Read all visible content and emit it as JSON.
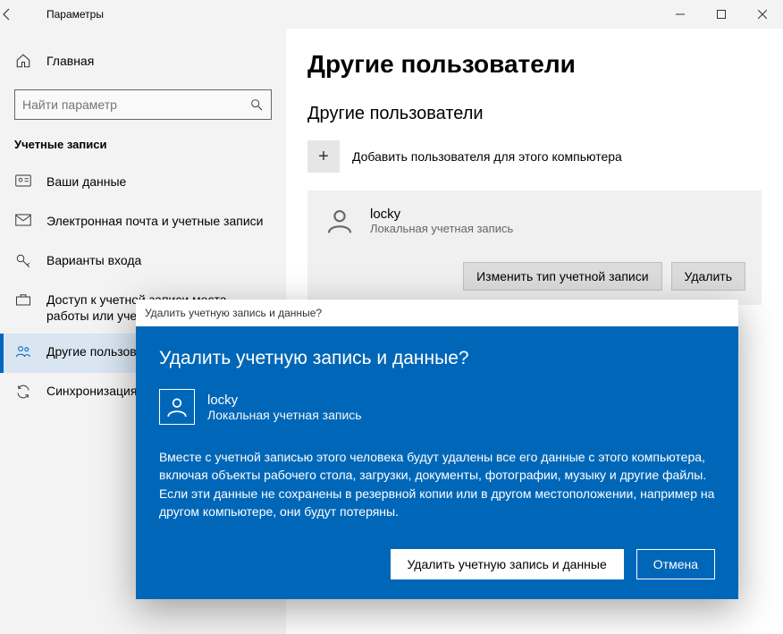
{
  "window": {
    "title": "Параметры"
  },
  "sidebar": {
    "home_label": "Главная",
    "search_placeholder": "Найти параметр",
    "section_title": "Учетные записи",
    "items": [
      {
        "label": "Ваши данные"
      },
      {
        "label": "Электронная почта и учетные записи"
      },
      {
        "label": "Варианты входа"
      },
      {
        "label": "Доступ к учетной записи места работы или учебного заведения"
      },
      {
        "label": "Другие пользователи"
      },
      {
        "label": "Синхронизация ваших параметров"
      }
    ]
  },
  "main": {
    "heading": "Другие пользователи",
    "sub_heading": "Другие пользователи",
    "add_user_label": "Добавить пользователя для этого компьютера",
    "user": {
      "name": "locky",
      "type": "Локальная учетная запись"
    },
    "change_type_label": "Изменить тип учетной записи",
    "delete_label": "Удалить"
  },
  "dialog": {
    "titlebar": "Удалить учетную запись и данные?",
    "heading": "Удалить учетную запись и данные?",
    "user": {
      "name": "locky",
      "type": "Локальная учетная запись"
    },
    "message": "Вместе с учетной записью этого человека будут удалены все его данные с этого компьютера, включая объекты рабочего стола, загрузки, документы, фотографии, музыку и другие файлы. Если эти данные не сохранены в резервной копии или в другом местоположении, например на другом компьютере, они будут потеряны.",
    "confirm_label": "Удалить учетную запись и данные",
    "cancel_label": "Отмена"
  }
}
